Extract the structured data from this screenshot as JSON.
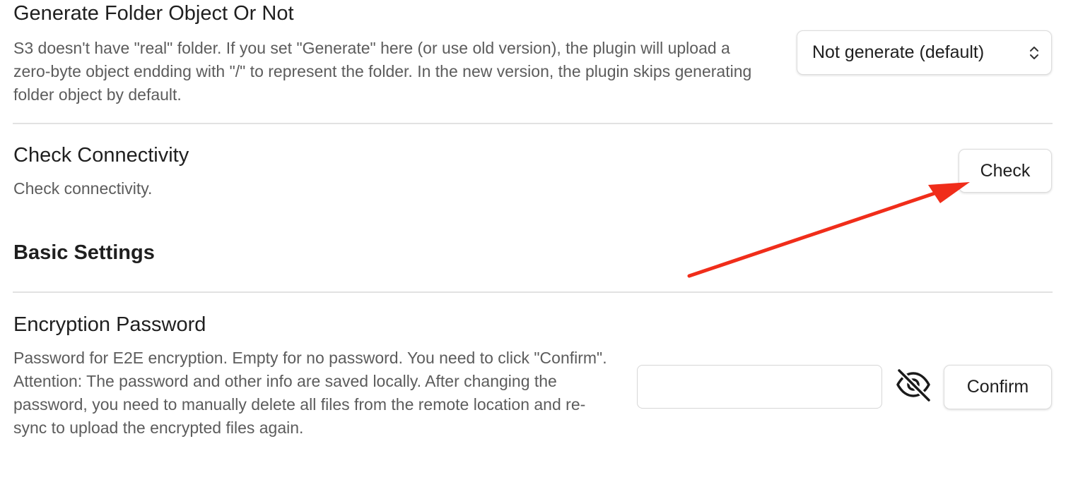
{
  "settings": {
    "folder_object": {
      "name": "Generate Folder Object Or Not",
      "desc": "S3 doesn't have \"real\" folder. If you set \"Generate\" here (or use old version), the plugin will upload a zero-byte object endding with \"/\" to represent the folder. In the new version, the plugin skips generating folder object by default.",
      "selected": "Not generate (default)",
      "chevron_icon": "up-down-chevron-icon"
    },
    "connectivity": {
      "name": "Check Connectivity",
      "desc": "Check connectivity.",
      "button_label": "Check"
    },
    "basic_heading": "Basic Settings",
    "encryption": {
      "name": "Encryption Password",
      "desc": "Password for E2E encryption. Empty for no password. You need to click \"Confirm\". Attention: The password and other info are saved locally. After changing the password, you need to manually delete all files from the remote location and re-sync to upload the encrypted files again.",
      "input_value": "",
      "toggle_icon": "eye-off-icon",
      "button_label": "Confirm"
    }
  },
  "annotation": {
    "arrow_color": "#f02d1a"
  }
}
